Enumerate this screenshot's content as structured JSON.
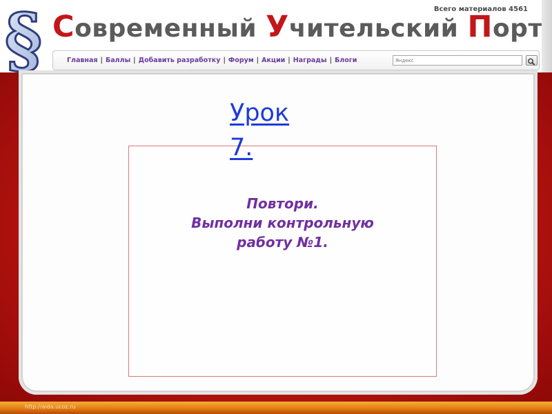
{
  "header": {
    "logo_symbol": "§",
    "title_parts": [
      {
        "cap": "С",
        "rest": "овременный "
      },
      {
        "cap": "У",
        "rest": "чительский "
      },
      {
        "cap": "П",
        "rest": "ортал"
      }
    ],
    "materials_count": "Всего материалов 4561"
  },
  "nav": {
    "items": [
      "Главная",
      "Баллы",
      "Добавить разработку",
      "Форум",
      "Акции",
      "Награды",
      "Блоги"
    ],
    "separator": "|",
    "search_placeholder": "Яндекс",
    "search_icon": "magnifier-icon"
  },
  "lesson": {
    "title": "Урок 7."
  },
  "task": {
    "lines": [
      "Повтори.",
      "Выполни контрольную",
      "работу №1."
    ]
  },
  "footer": {
    "url": "http://aida.ucoz.ru"
  },
  "colors": {
    "accent_red": "#c3161a",
    "nav_purple": "#6a3b9a",
    "link_blue": "#1c3bd9",
    "task_purple": "#7030a0",
    "frame_red": "#b8140f"
  }
}
